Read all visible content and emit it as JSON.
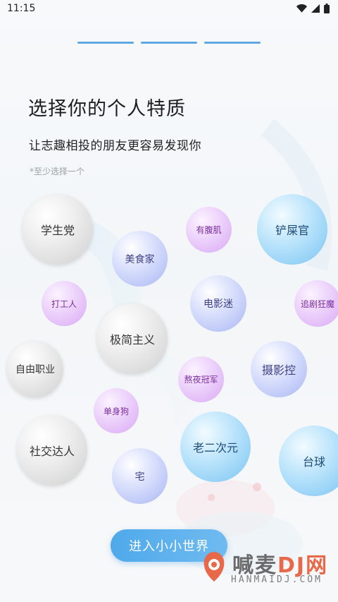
{
  "status_bar": {
    "time": "11:15"
  },
  "header": {
    "title": "选择你的个人特质",
    "subtitle": "让志趣相投的朋友更容易发现你",
    "hint": "*至少选择一个"
  },
  "progress": {
    "current_step": 3,
    "total_steps": 3
  },
  "traits": [
    {
      "label": "学生党",
      "style": "gray"
    },
    {
      "label": "美食家",
      "style": "blue"
    },
    {
      "label": "有腹肌",
      "style": "purple"
    },
    {
      "label": "铲屎官",
      "style": "cyan"
    },
    {
      "label": "打工人",
      "style": "purple"
    },
    {
      "label": "电影迷",
      "style": "blue"
    },
    {
      "label": "追剧狂魔",
      "style": "purple"
    },
    {
      "label": "极简主义",
      "style": "gray"
    },
    {
      "label": "自由职业",
      "style": "gray"
    },
    {
      "label": "熬夜冠军",
      "style": "purple"
    },
    {
      "label": "摄影控",
      "style": "blue"
    },
    {
      "label": "单身狗",
      "style": "purple"
    },
    {
      "label": "老二次元",
      "style": "cyan"
    },
    {
      "label": "社交达人",
      "style": "gray"
    },
    {
      "label": "宅",
      "style": "blue"
    },
    {
      "label": "台球",
      "style": "cyan"
    }
  ],
  "cta": {
    "label": "进入小小世界"
  },
  "watermark": {
    "main": "喊麦",
    "brand": "DJ网",
    "url": "HANMAIDJ.COM"
  }
}
